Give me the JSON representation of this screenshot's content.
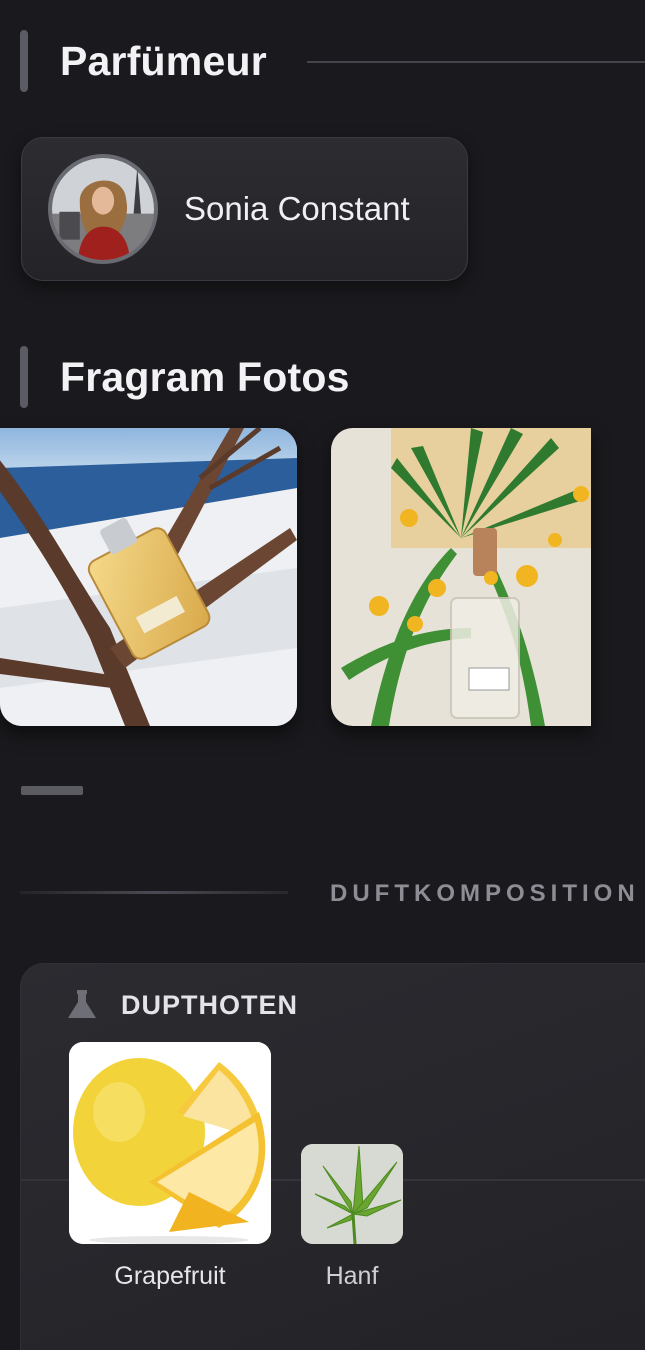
{
  "perfumer_section": {
    "title": "Parfümeur"
  },
  "perfumer": {
    "name": "Sonia Constant"
  },
  "photos_section": {
    "title": "Fragram Fotos"
  },
  "photos": [
    {
      "name": "perfume-bottle-on-branch-snow"
    },
    {
      "name": "perfume-bottle-with-flowers"
    }
  ],
  "composition": {
    "label": "DUFTKOMPOSITION"
  },
  "notes_group": {
    "title": "DUPTHOTEN",
    "icon": "flask-icon",
    "notes": [
      {
        "label": "Grapefruit"
      },
      {
        "label": "Hanf"
      }
    ]
  },
  "colors": {
    "background": "#1a1a1e",
    "card": "#2a2a2f",
    "accent_bar": "#5b5b64"
  }
}
